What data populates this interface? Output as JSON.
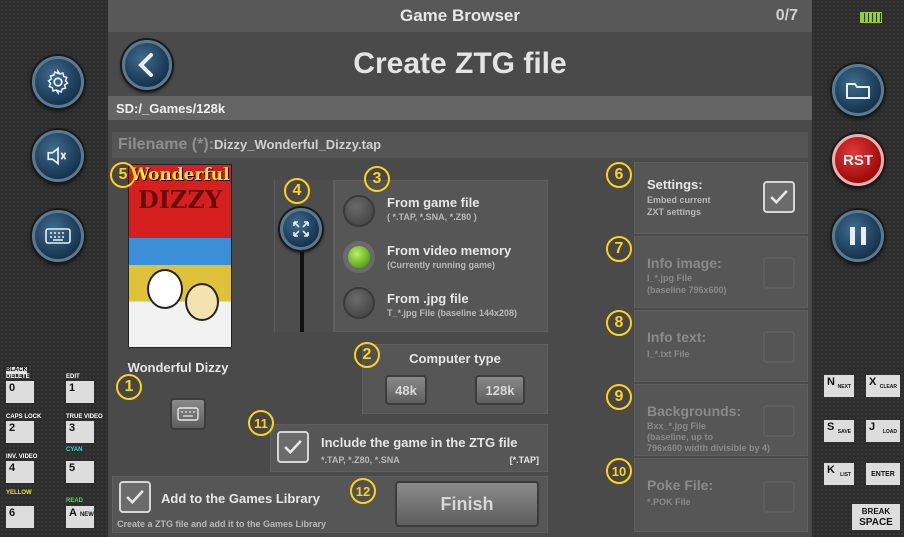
{
  "window": {
    "title": "Game Browser",
    "counter": "0/7"
  },
  "header": {
    "title": "Create ZTG file"
  },
  "path": "SD:/_Games/128k",
  "filename": {
    "label": "Filename (*):",
    "value": "Dizzy_Wonderful_Dizzy.tap"
  },
  "game": {
    "name": "Wonderful Dizzy",
    "cover_text": [
      "Wonderful",
      "DIZZY"
    ]
  },
  "source": {
    "options": [
      {
        "label": "From game file",
        "sub": "( *.TAP, *.SNA, *.Z80 )",
        "selected": false
      },
      {
        "label": "From video memory",
        "sub": "(Currently running game)",
        "selected": true
      },
      {
        "label": "From .jpg file",
        "sub": "T_*.jpg File (baseline 144x208)",
        "selected": false
      }
    ]
  },
  "computer_type": {
    "label": "Computer type",
    "options": [
      "48k",
      "128k"
    ]
  },
  "include_game": {
    "label": "Include the game in the ZTG file",
    "sub": "*.TAP, *.Z80, *.SNA",
    "tag": "[*.TAP]",
    "checked": true
  },
  "library": {
    "label": "Add to the Games Library",
    "sub": "Create a ZTG file and add it to the Games Library",
    "checked": true
  },
  "finish_label": "Finish",
  "extras": [
    {
      "label": "Settings:",
      "sub1": "Embed current",
      "sub2": "ZXT settings",
      "sub3": "",
      "checked": true,
      "enabled": true,
      "num": "6"
    },
    {
      "label": "Info image:",
      "sub1": "I_*.jpg File",
      "sub2": "(baseline 796x600)",
      "sub3": "",
      "checked": false,
      "enabled": false,
      "num": "7"
    },
    {
      "label": "Info text:",
      "sub1": "I_*.txt File",
      "sub2": "",
      "sub3": "",
      "checked": false,
      "enabled": false,
      "num": "8"
    },
    {
      "label": "Backgrounds:",
      "sub1": "Bxx_*.jpg File",
      "sub2": "(baseline, up to",
      "sub3": "796x600 width divisible by 4)",
      "checked": false,
      "enabled": false,
      "num": "9"
    },
    {
      "label": "Poke File:",
      "sub1": "*.POK File",
      "sub2": "",
      "sub3": "",
      "checked": false,
      "enabled": false,
      "num": "10"
    }
  ],
  "markers": [
    "1",
    "2",
    "3",
    "4",
    "5",
    "11",
    "12"
  ],
  "right_buttons": {
    "rst": "RST"
  },
  "left_keys": [
    {
      "key": "0",
      "top": "BLACK",
      "top2": "DELETE",
      "bottom": ""
    },
    {
      "key": "1",
      "top": "EDIT",
      "top2": "",
      "bottom": ""
    },
    {
      "key": "2",
      "top": "CAPS LOCK",
      "top2": "",
      "bottom": ""
    },
    {
      "key": "3",
      "top": "TRUE VIDEO",
      "top2": "",
      "bottom": ""
    },
    {
      "key": "4",
      "top": "INV. VIDEO",
      "top2": "",
      "bottom": ""
    },
    {
      "key": "5",
      "top": "CYAN",
      "top2": "",
      "bottom": ""
    },
    {
      "key": "6",
      "top": "YELLOW",
      "top2": "",
      "bottom": ""
    },
    {
      "key": "A",
      "top": "READ",
      "top2": "",
      "bottom": "NEW"
    }
  ],
  "right_keys": [
    {
      "key": "N",
      "word": "NEXT"
    },
    {
      "key": "X",
      "word": "CLEAR"
    },
    {
      "key": "S",
      "word": "SAVE"
    },
    {
      "key": "J",
      "word": "LOAD"
    },
    {
      "key": "K",
      "word": "LIST"
    },
    {
      "key": "",
      "word": "ENTER"
    }
  ],
  "break_space": [
    "BREAK",
    "SPACE"
  ],
  "colors": {
    "accent_yellow": "#ffd21a",
    "radio_on": "#7fd12a",
    "rst_red": "#c81414"
  }
}
